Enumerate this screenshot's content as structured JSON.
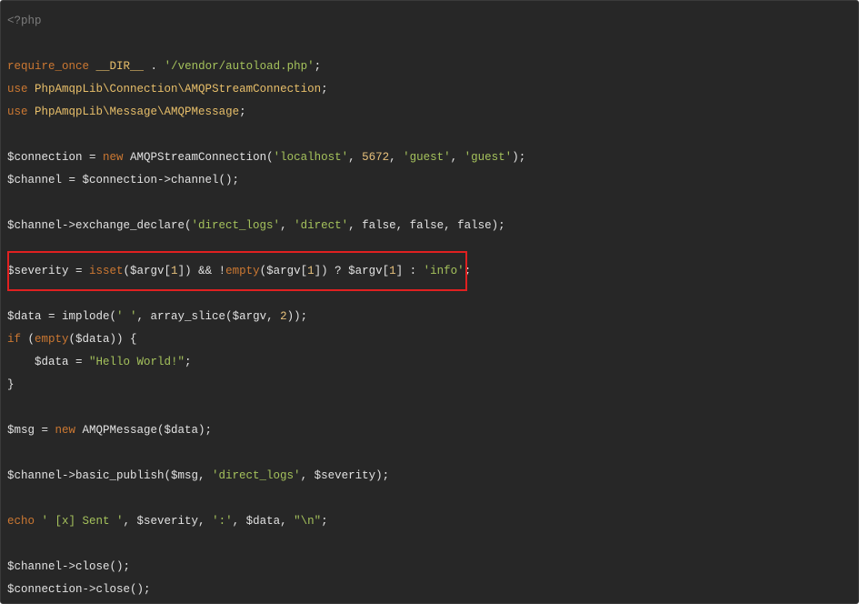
{
  "colors": {
    "background": "#272727",
    "plain": "#e2e2e2",
    "tag": "#7c7c7c",
    "keyword": "#cc7832",
    "string": "#a5c25c",
    "number": "#e6c07b",
    "class": "#e8bf6a",
    "highlight_border": "#e02020"
  },
  "code": {
    "language": "php",
    "highlighted_line_index": 11,
    "lines": [
      [
        {
          "t": "tag",
          "v": "<?php"
        }
      ],
      [],
      [
        {
          "t": "kw",
          "v": "require_once"
        },
        {
          "t": "plain",
          "v": " "
        },
        {
          "t": "class",
          "v": "__DIR__"
        },
        {
          "t": "plain",
          "v": " . "
        },
        {
          "t": "str",
          "v": "'/vendor/autoload.php'"
        },
        {
          "t": "plain",
          "v": ";"
        }
      ],
      [
        {
          "t": "kw",
          "v": "use"
        },
        {
          "t": "plain",
          "v": " "
        },
        {
          "t": "class",
          "v": "PhpAmqpLib\\Connection\\AMQPStreamConnection"
        },
        {
          "t": "plain",
          "v": ";"
        }
      ],
      [
        {
          "t": "kw",
          "v": "use"
        },
        {
          "t": "plain",
          "v": " "
        },
        {
          "t": "class",
          "v": "PhpAmqpLib\\Message\\AMQPMessage"
        },
        {
          "t": "plain",
          "v": ";"
        }
      ],
      [],
      [
        {
          "t": "plain",
          "v": "$connection = "
        },
        {
          "t": "kw",
          "v": "new"
        },
        {
          "t": "plain",
          "v": " AMQPStreamConnection("
        },
        {
          "t": "str",
          "v": "'localhost'"
        },
        {
          "t": "plain",
          "v": ", "
        },
        {
          "t": "num",
          "v": "5672"
        },
        {
          "t": "plain",
          "v": ", "
        },
        {
          "t": "str",
          "v": "'guest'"
        },
        {
          "t": "plain",
          "v": ", "
        },
        {
          "t": "str",
          "v": "'guest'"
        },
        {
          "t": "plain",
          "v": ");"
        }
      ],
      [
        {
          "t": "plain",
          "v": "$channel = $connection->channel();"
        }
      ],
      [],
      [
        {
          "t": "plain",
          "v": "$channel->exchange_declare("
        },
        {
          "t": "str",
          "v": "'direct_logs'"
        },
        {
          "t": "plain",
          "v": ", "
        },
        {
          "t": "str",
          "v": "'direct'"
        },
        {
          "t": "plain",
          "v": ", false, false, false);"
        }
      ],
      [],
      [
        {
          "t": "plain",
          "v": "$severity = "
        },
        {
          "t": "kw",
          "v": "isset"
        },
        {
          "t": "plain",
          "v": "($argv["
        },
        {
          "t": "num",
          "v": "1"
        },
        {
          "t": "plain",
          "v": "]) && !"
        },
        {
          "t": "kw",
          "v": "empty"
        },
        {
          "t": "plain",
          "v": "($argv["
        },
        {
          "t": "num",
          "v": "1"
        },
        {
          "t": "plain",
          "v": "]) ? $argv["
        },
        {
          "t": "num",
          "v": "1"
        },
        {
          "t": "plain",
          "v": "] : "
        },
        {
          "t": "str",
          "v": "'info'"
        },
        {
          "t": "plain",
          "v": ";"
        }
      ],
      [],
      [
        {
          "t": "plain",
          "v": "$data = implode("
        },
        {
          "t": "str",
          "v": "' '"
        },
        {
          "t": "plain",
          "v": ", array_slice($argv, "
        },
        {
          "t": "num",
          "v": "2"
        },
        {
          "t": "plain",
          "v": "));"
        }
      ],
      [
        {
          "t": "kw",
          "v": "if"
        },
        {
          "t": "plain",
          "v": " ("
        },
        {
          "t": "kw",
          "v": "empty"
        },
        {
          "t": "plain",
          "v": "($data)) {"
        }
      ],
      [
        {
          "t": "plain",
          "v": "    $data = "
        },
        {
          "t": "str",
          "v": "\"Hello World!\""
        },
        {
          "t": "plain",
          "v": ";"
        }
      ],
      [
        {
          "t": "plain",
          "v": "}"
        }
      ],
      [],
      [
        {
          "t": "plain",
          "v": "$msg = "
        },
        {
          "t": "kw",
          "v": "new"
        },
        {
          "t": "plain",
          "v": " AMQPMessage($data);"
        }
      ],
      [],
      [
        {
          "t": "plain",
          "v": "$channel->basic_publish($msg, "
        },
        {
          "t": "str",
          "v": "'direct_logs'"
        },
        {
          "t": "plain",
          "v": ", $severity);"
        }
      ],
      [],
      [
        {
          "t": "kw",
          "v": "echo"
        },
        {
          "t": "plain",
          "v": " "
        },
        {
          "t": "str",
          "v": "' [x] Sent '"
        },
        {
          "t": "plain",
          "v": ", $severity, "
        },
        {
          "t": "str",
          "v": "':'"
        },
        {
          "t": "plain",
          "v": ", $data, "
        },
        {
          "t": "str",
          "v": "\"\\n\""
        },
        {
          "t": "plain",
          "v": ";"
        }
      ],
      [],
      [
        {
          "t": "plain",
          "v": "$channel->close();"
        }
      ],
      [
        {
          "t": "plain",
          "v": "$connection->close();"
        }
      ]
    ]
  }
}
